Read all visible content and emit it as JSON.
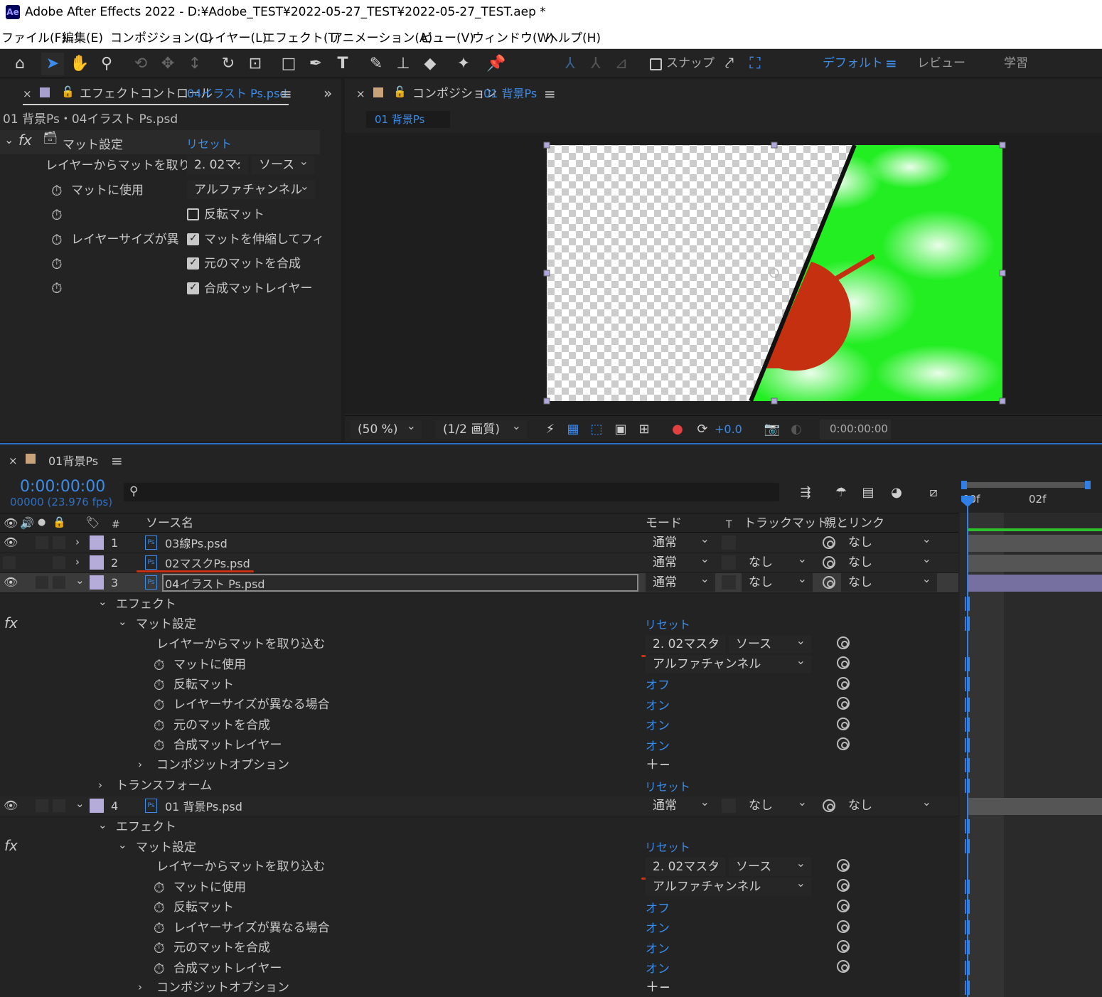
{
  "titlebar": {
    "app_icon": "Ae",
    "title": "Adobe After Effects 2022 - D:¥Adobe_TEST¥2022-05-27_TEST¥2022-05-27_TEST.aep *"
  },
  "menu": [
    "ファイル(F)",
    "編集(E)",
    "コンポジション(C)",
    "レイヤー(L)",
    "エフェクト(T)",
    "アニメーション(A)",
    "ビュー(V)",
    "ウィンドウ(W)",
    "ヘルプ(H)"
  ],
  "toolbar": {
    "snap_label": "スナップ",
    "workspaces": [
      "デフォルト",
      "レビュー",
      "学習"
    ]
  },
  "effect_panel": {
    "tab_label": "エフェクトコントロール",
    "tab_layer": "04イラスト Ps.psd",
    "breadcrumb": "01 背景Ps・04イラスト Ps.psd",
    "effect_name": "マット設定",
    "reset": "リセット",
    "rows": {
      "layer_label": "レイヤーからマットを取り",
      "layer_value": "2. 02マ:",
      "source_value": "ソース",
      "use_label": "マットに使用",
      "use_value": "アルファチャンネル",
      "invert_label": "反転マット",
      "size_label": "レイヤーサイズが異",
      "stretch_label": "マットを伸縮してフィ",
      "composite_label": "元のマットを合成",
      "premult_label": "合成マットレイヤー"
    }
  },
  "comp_panel": {
    "tab_label": "コンポジション",
    "tab_name": "01 背景Ps",
    "subtab": "01 背景Ps",
    "zoom": "(50 %)",
    "resolution": "(1/2 画質)",
    "exposure": "+0.0",
    "timecode": "0:00:00:00"
  },
  "timeline": {
    "tab": "01背景Ps",
    "timecode": "0:00:00:00",
    "frame_info": "00000 (23.976 fps)",
    "ruler": [
      "00f",
      "02f"
    ],
    "headers": {
      "num": "#",
      "source": "ソース名",
      "mode": "モード",
      "t": "T",
      "trackmatte": "トラックマット",
      "parent": "親とリンク"
    },
    "layers": [
      {
        "num": "1",
        "name": "03線Ps.psd",
        "mode": "通常",
        "matte": "",
        "parent": "なし"
      },
      {
        "num": "2",
        "name": "02マスクPs.psd",
        "mode": "通常",
        "matte": "なし",
        "parent": "なし"
      },
      {
        "num": "3",
        "name": "04イラスト Ps.psd",
        "mode": "通常",
        "matte": "なし",
        "parent": "なし"
      },
      {
        "num": "4",
        "name": "01 背景Ps.psd",
        "mode": "通常",
        "matte": "なし",
        "parent": "なし"
      }
    ],
    "props": {
      "effects": "エフェクト",
      "matte_settings": "マット設定",
      "reset": "リセット",
      "take_matte": "レイヤーからマットを取り込む",
      "layer_value": "2. 02マスク",
      "source_value": "ソース",
      "use_matte": "マットに使用",
      "use_value": "アルファチャンネル",
      "invert": "反転マット",
      "size_diff": "レイヤーサイズが異なる場合",
      "composite": "元のマットを合成",
      "premult": "合成マットレイヤー",
      "composite_opts": "コンポジットオプション",
      "transform": "トランスフォーム",
      "off": "オフ",
      "on": "オン",
      "plusminus": "＋−"
    }
  }
}
